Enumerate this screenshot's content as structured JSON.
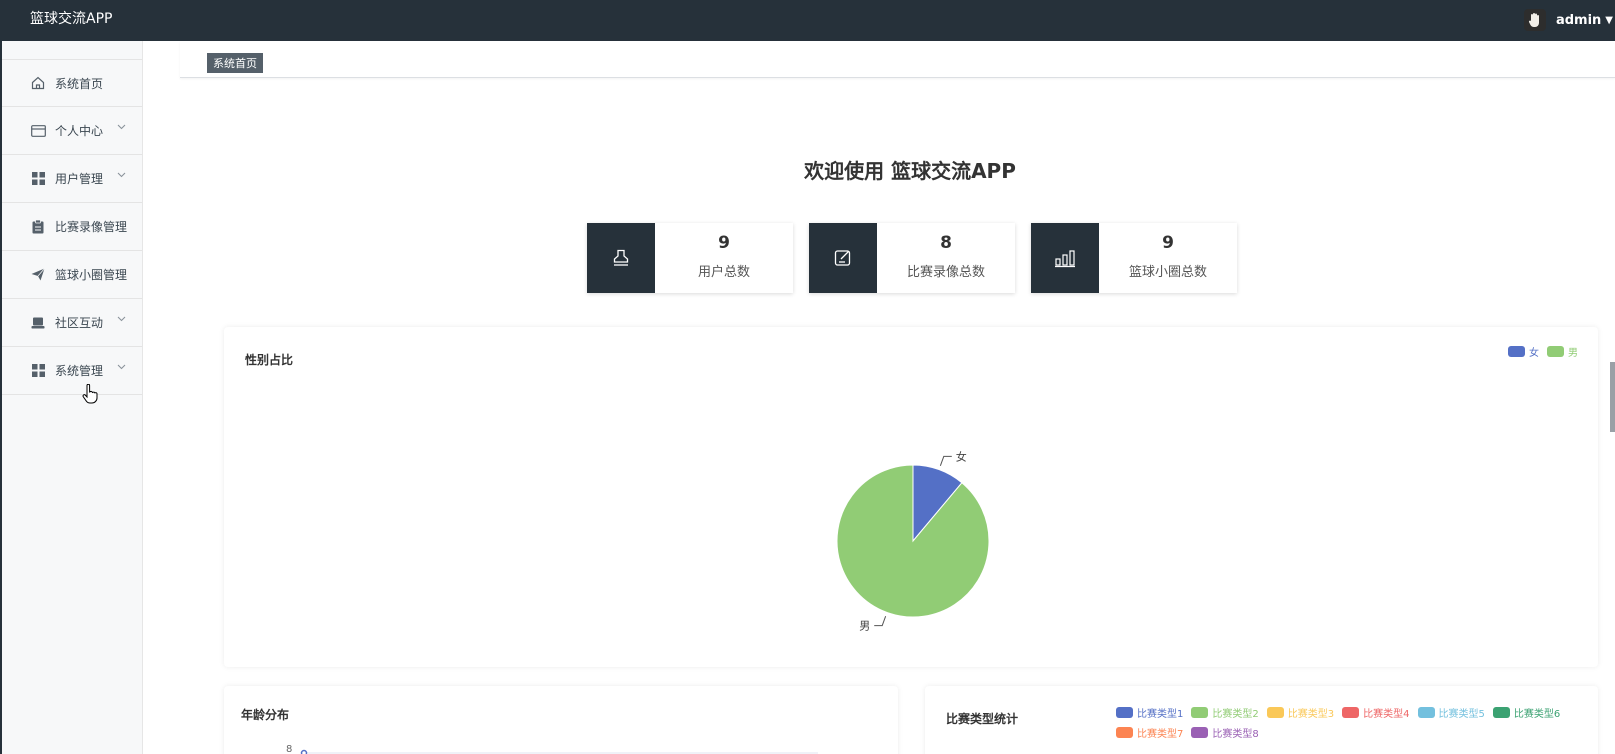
{
  "header": {
    "app_title": "篮球交流APP",
    "username": "admin"
  },
  "sidebar": {
    "items": [
      {
        "label": "系统首页",
        "icon": "home-icon",
        "has_children": false
      },
      {
        "label": "个人中心",
        "icon": "card-icon",
        "has_children": true
      },
      {
        "label": "用户管理",
        "icon": "grid-icon",
        "has_children": true
      },
      {
        "label": "比赛录像管理",
        "icon": "clipboard-icon",
        "has_children": false
      },
      {
        "label": "篮球小圈管理",
        "icon": "send-icon",
        "has_children": false
      },
      {
        "label": "社区互动",
        "icon": "laptop-icon",
        "has_children": true
      },
      {
        "label": "系统管理",
        "icon": "grid-icon",
        "has_children": true
      }
    ]
  },
  "breadcrumb": {
    "current": "系统首页"
  },
  "welcome": {
    "text": "欢迎使用 篮球交流APP"
  },
  "stats": [
    {
      "value": "9",
      "label": "用户总数",
      "icon": "stamp-icon"
    },
    {
      "value": "8",
      "label": "比赛录像总数",
      "icon": "edit-icon"
    },
    {
      "value": "9",
      "label": "篮球小圈总数",
      "icon": "bar-chart-icon"
    }
  ],
  "gender_panel": {
    "title": "性别占比"
  },
  "age_panel": {
    "title": "年龄分布",
    "y_top_tick": "8"
  },
  "match_type_panel": {
    "title": "比赛类型统计"
  },
  "colors": {
    "dark": "#26313a",
    "female": "#5470c6",
    "male": "#91cc75"
  },
  "chart_data": [
    {
      "type": "pie",
      "title": "性别占比",
      "legend_position": "top-right",
      "slices": [
        {
          "name": "女",
          "value": 1,
          "color": "#5470c6"
        },
        {
          "name": "男",
          "value": 8,
          "color": "#91cc75"
        }
      ]
    },
    {
      "type": "pie",
      "title": "比赛类型统计",
      "legend_position": "top-right",
      "legend": [
        {
          "name": "比赛类型1",
          "color": "#5470c6"
        },
        {
          "name": "比赛类型2",
          "color": "#91cc75"
        },
        {
          "name": "比赛类型3",
          "color": "#fac858"
        },
        {
          "name": "比赛类型4",
          "color": "#ee6666"
        },
        {
          "name": "比赛类型5",
          "color": "#73c0de"
        },
        {
          "name": "比赛类型6",
          "color": "#3ba272"
        },
        {
          "name": "比赛类型7",
          "color": "#fc8452"
        },
        {
          "name": "比赛类型8",
          "color": "#9a60b4"
        }
      ]
    }
  ]
}
